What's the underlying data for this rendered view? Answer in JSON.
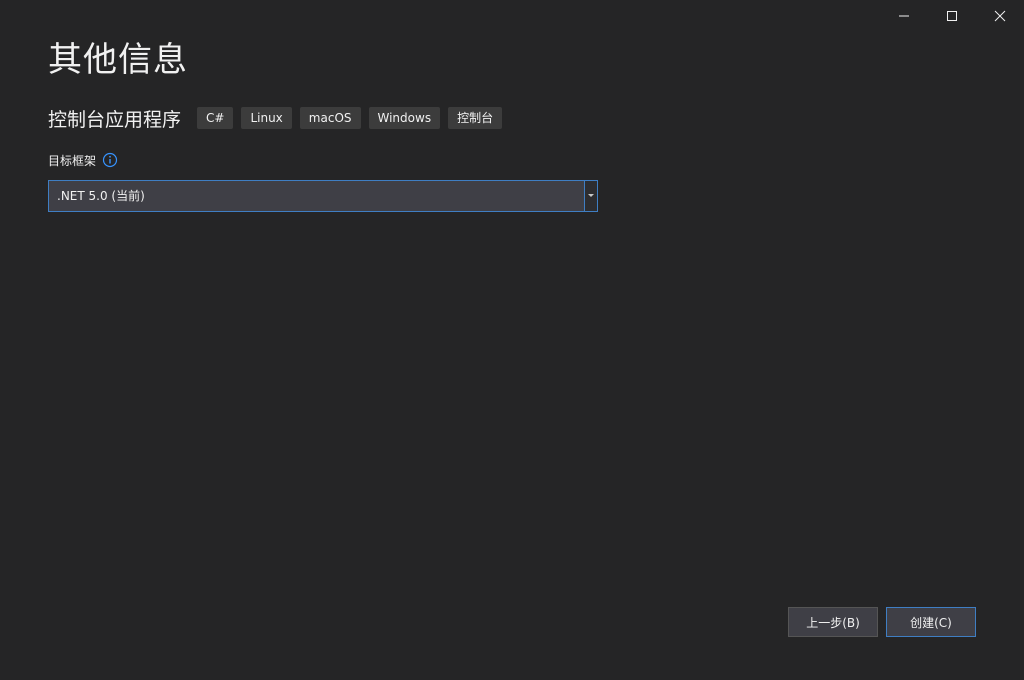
{
  "window": {
    "caption_buttons": [
      "minimize-icon",
      "maximize-icon",
      "close-icon"
    ]
  },
  "page": {
    "title": "其他信息",
    "project_type": "控制台应用程序",
    "tags": [
      "C#",
      "Linux",
      "macOS",
      "Windows",
      "控制台"
    ]
  },
  "form": {
    "framework_label": "目标框架",
    "framework_value": ".NET 5.0 (当前)",
    "info_icon": "info-icon"
  },
  "footer": {
    "back_label": "上一步(B)",
    "create_label": "创建(C)"
  },
  "colors": {
    "background": "#252526",
    "accent": "#3f7ec3",
    "control_bg": "#3f3f46",
    "tag_bg": "#3c3c3c",
    "info_icon": "#3794ff"
  }
}
